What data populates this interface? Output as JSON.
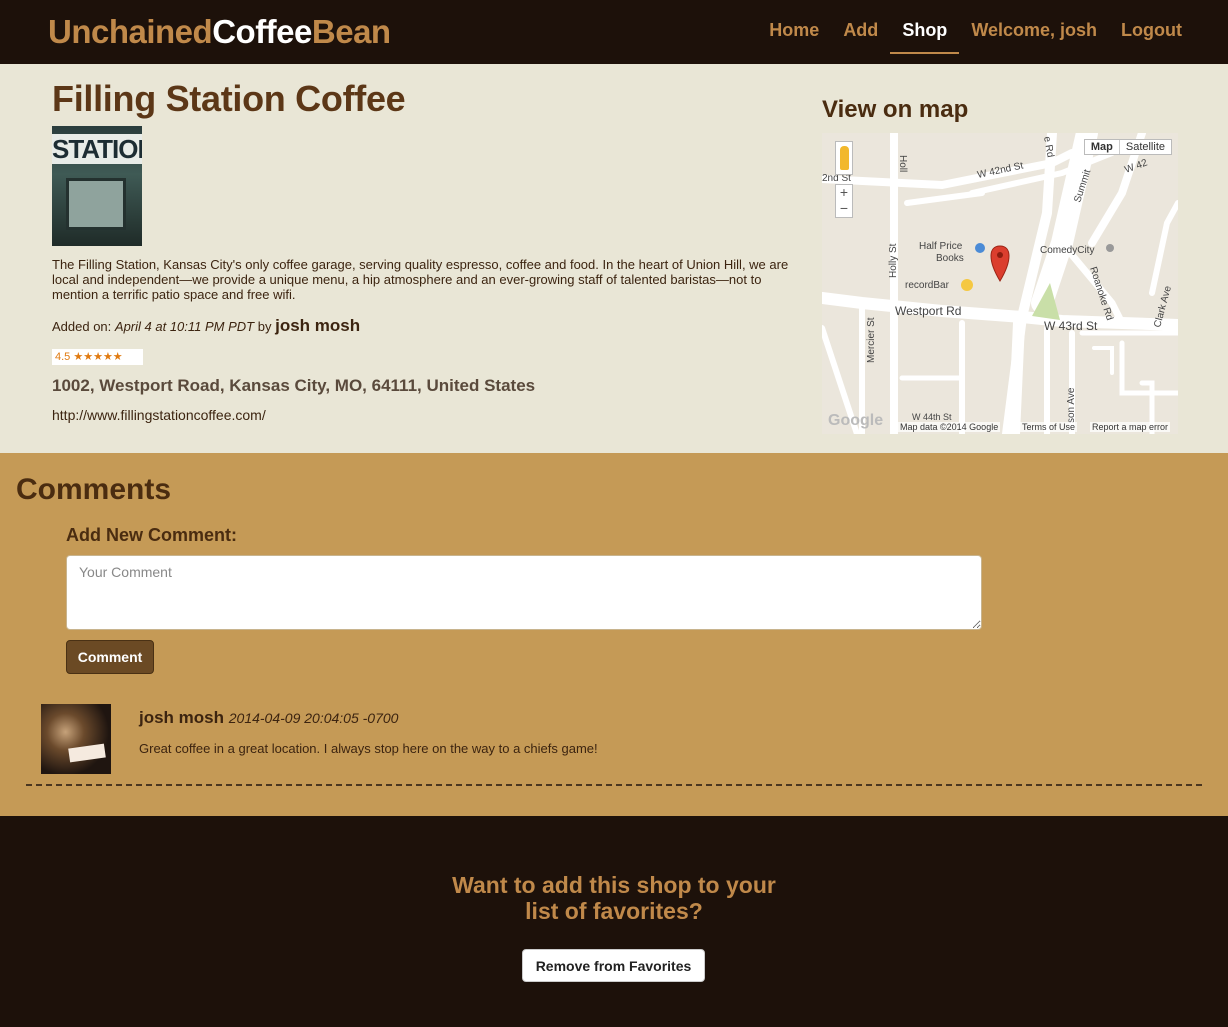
{
  "brand": {
    "part1": "Unchained",
    "part2": "Coffee",
    "part3": "Bean"
  },
  "nav": {
    "items": [
      {
        "label": "Home"
      },
      {
        "label": "Add"
      },
      {
        "label": "Shop"
      },
      {
        "label": "Welcome, josh"
      },
      {
        "label": "Logout"
      }
    ],
    "active": "Shop"
  },
  "shop": {
    "name": "Filling Station Coffee",
    "photo_sign": "STATION",
    "description": "The Filling Station, Kansas City's only coffee garage, serving quality espresso, coffee and food. In the heart of Union Hill, we are local and independent—we provide a unique menu, a hip atmosphere and an ever-growing staff of talented baristas—not to mention a terrific patio space and free wifi.",
    "added_prefix": "Added on:",
    "added_date": "April 4 at 10:11 PM PDT",
    "added_by": "by",
    "author": "josh mosh",
    "rating": "4.5",
    "rating_stars": "★★★★★",
    "address": "1002, Westport Road, Kansas City, MO, 64111, United States",
    "url": "http://www.fillingstationcoffee.com/"
  },
  "map": {
    "title": "View on map",
    "type_map": "Map",
    "type_satellite": "Satellite",
    "zoom_in": "+",
    "zoom_out": "−",
    "labels": {
      "w42": "W 42nd St",
      "nd2": "2nd St",
      "summit": "Summit",
      "w42b": "W 42",
      "halfprice1": "Half Price",
      "halfprice2": "Books",
      "comedycity": "ComedyCity",
      "recordbar": "recordBar",
      "holly": "Holly St",
      "westport": "Westport Rd",
      "w43": "W 43rd St",
      "roanoke": "Roanoke Rd",
      "clark": "Clark Ave",
      "mercier": "Mercier St",
      "w44": "W 44th St",
      "sonave": "son Ave",
      "holl": "Holl",
      "erd": "e Rd"
    },
    "footer_google": "Google",
    "footer_data": "Map data ©2014 Google",
    "footer_terms": "Terms of Use",
    "footer_report": "Report a map error"
  },
  "comments": {
    "title": "Comments",
    "add_label": "Add New Comment:",
    "placeholder": "Your Comment",
    "button": "Comment",
    "items": [
      {
        "author": "josh mosh",
        "date": "2014-04-09 20:04:05 -0700",
        "text": "Great coffee in a great location. I always stop here on the way to a chiefs game!"
      }
    ]
  },
  "favorites": {
    "question_line1": "Want to add this shop to your",
    "question_line2": "list of favorites?",
    "button": "Remove from Favorites"
  }
}
